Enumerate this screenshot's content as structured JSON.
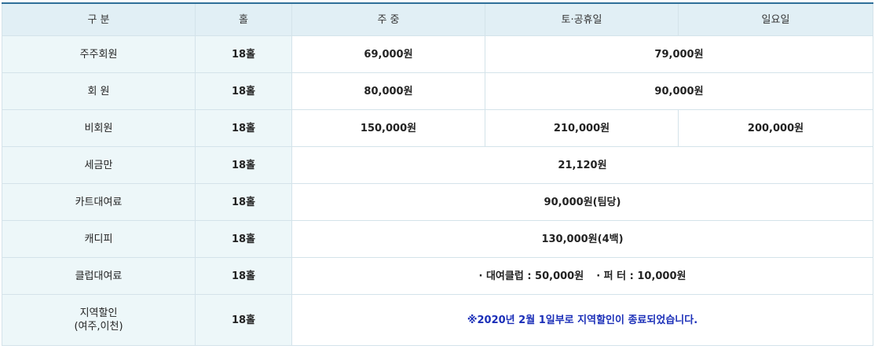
{
  "header": {
    "category": "구 분",
    "holes": "홀",
    "weekday": "주 중",
    "saturday_holiday": "토·공휴일",
    "sunday": "일요일"
  },
  "rows": {
    "weekday_member": {
      "label": "주주회원",
      "holes": "18홀",
      "weekday": "69,000원",
      "weekend": "79,000원"
    },
    "member": {
      "label": "회 원",
      "holes": "18홀",
      "weekday": "80,000원",
      "weekend": "90,000원"
    },
    "non_member": {
      "label": "비회원",
      "holes": "18홀",
      "weekday": "150,000원",
      "saturday_holiday": "210,000원",
      "sunday": "200,000원"
    },
    "tax": {
      "label": "세금만",
      "holes": "18홀",
      "value": "21,120원"
    },
    "cart": {
      "label": "카트대여료",
      "holes": "18홀",
      "value": "90,000원(팀당)"
    },
    "caddie": {
      "label": "캐디피",
      "holes": "18홀",
      "value": "130,000원(4백)"
    },
    "club_rental": {
      "label": "클럽대여료",
      "holes": "18홀",
      "club_value": "· 대여클럽 : 50,000원",
      "putter_value": "· 퍼 터 : 10,000원"
    },
    "local_discount": {
      "label_line1": "지역할인",
      "label_line2": "(여주,이천)",
      "holes": "18홀",
      "notice": "※2020년 2월 1일부로 지역할인이 종료되었습니다."
    }
  },
  "colors": {
    "header_bg": "#e1eff5",
    "label_bg": "#edf7f9",
    "top_border": "#2f6f99",
    "notice_text": "#1b2fb8"
  }
}
